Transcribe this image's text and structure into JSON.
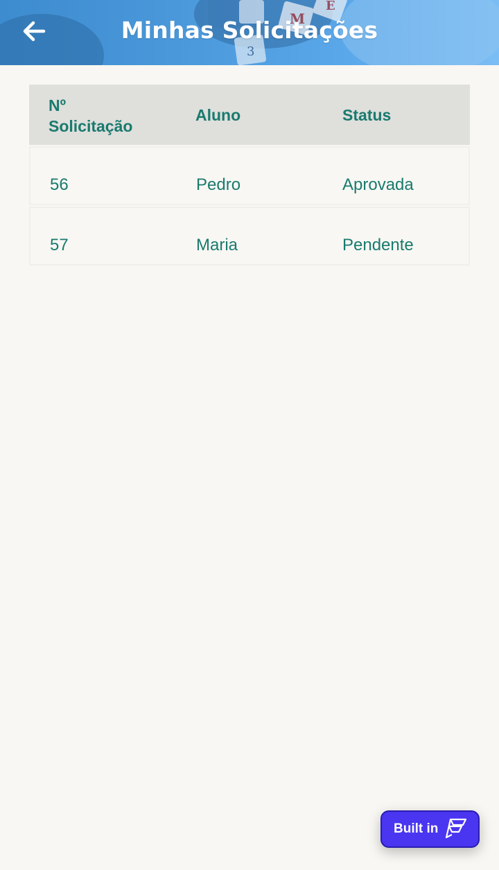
{
  "header": {
    "title": "Minhas Solicitações"
  },
  "table": {
    "columns": [
      "Nº\nSolicitação",
      "Aluno",
      "Status"
    ],
    "col1_line1": "Nº",
    "col1_line2": "Solicitação",
    "rows": [
      {
        "id": "56",
        "aluno": "Pedro",
        "status": "Aprovada"
      },
      {
        "id": "57",
        "aluno": "Maria",
        "status": "Pendente"
      }
    ]
  },
  "badge": {
    "label": "Built in"
  },
  "colors": {
    "accent_text": "#1a7a6e",
    "header_bg": "#4a98da",
    "badge_bg": "#4a35f0",
    "table_header_bg": "#dfdfdc"
  },
  "icons": {
    "back": "arrow-left-icon",
    "badge_logo": "flutterflow-logo-icon"
  }
}
